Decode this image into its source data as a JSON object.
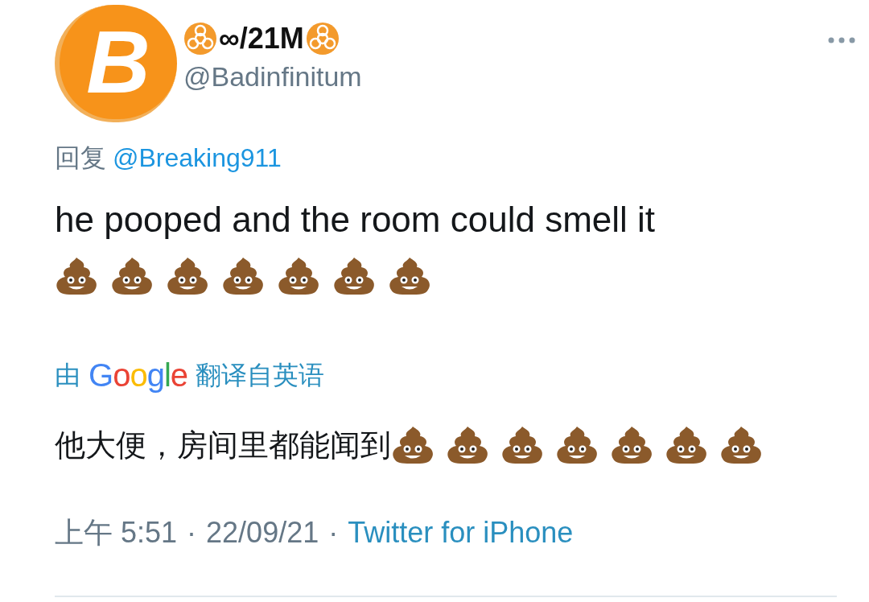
{
  "author": {
    "avatar_glyph": "B",
    "name": "∞/21M",
    "handle": "@Badinfinitum"
  },
  "reply_to": {
    "prefix": "回复",
    "handle": "@Breaking911"
  },
  "text": "he pooped and the room could smell it",
  "emojis": [
    {
      "kind": "poop"
    },
    {
      "kind": "poop"
    },
    {
      "kind": "poop"
    },
    {
      "kind": "poop"
    },
    {
      "kind": "poop"
    },
    {
      "kind": "poop"
    },
    {
      "kind": "poop"
    }
  ],
  "translation": {
    "by": "由",
    "brand": "Google",
    "note": "翻译自英语",
    "text": "他大便，房间里都能闻到",
    "emojis": [
      {
        "kind": "poop"
      },
      {
        "kind": "poop"
      },
      {
        "kind": "poop"
      },
      {
        "kind": "poop"
      },
      {
        "kind": "poop"
      },
      {
        "kind": "poop"
      },
      {
        "kind": "poop"
      }
    ]
  },
  "meta": {
    "time": "上午 5:51",
    "sep1": "·",
    "date": "22/09/21",
    "sep2": "·",
    "source": "Twitter for iPhone"
  }
}
